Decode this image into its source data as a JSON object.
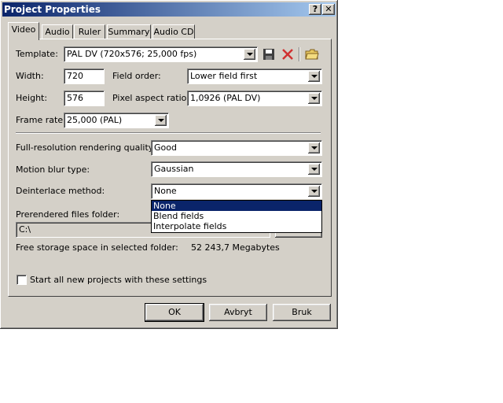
{
  "window": {
    "title": "Project Properties",
    "help_glyph": "?",
    "close_glyph": "✕"
  },
  "tabs": [
    {
      "label": "Video",
      "active": true
    },
    {
      "label": "Audio"
    },
    {
      "label": "Ruler"
    },
    {
      "label": "Summary"
    },
    {
      "label": "Audio CD"
    }
  ],
  "video": {
    "template_label": "Template:",
    "template_value": "PAL DV (720x576; 25,000 fps)",
    "width_label": "Width:",
    "width_value": "720",
    "height_label": "Height:",
    "height_value": "576",
    "field_order_label": "Field order:",
    "field_order_value": "Lower field first",
    "pixel_aspect_label": "Pixel aspect ratio:",
    "pixel_aspect_value": "1,0926 (PAL DV)",
    "frame_rate_label": "Frame rate:",
    "frame_rate_value": "25,000 (PAL)",
    "render_quality_label": "Full-resolution rendering quality:",
    "render_quality_value": "Good",
    "motion_blur_label": "Motion blur type:",
    "motion_blur_value": "Gaussian",
    "deinterlace_label": "Deinterlace method:",
    "deinterlace_value": "None",
    "deinterlace_options": [
      "None",
      "Blend fields",
      "Interpolate fields"
    ],
    "prerendered_label": "Prerendered files folder:",
    "prerendered_value": "C:\\",
    "free_space_label": "Free storage space in selected folder:",
    "free_space_value": "52 243,7 Megabytes",
    "start_all_label": "Start all new projects with these settings"
  },
  "icons": {
    "save": "floppy-disk-icon",
    "delete": "red-x-icon",
    "folder": "folder-icon"
  },
  "colors": {
    "title_bar": "#0a246a",
    "selection": "#0a246a",
    "face": "#d4d0c8",
    "delete_red": "#d03030"
  },
  "buttons": {
    "ok": "OK",
    "cancel": "Avbryt",
    "apply": "Bruk"
  }
}
